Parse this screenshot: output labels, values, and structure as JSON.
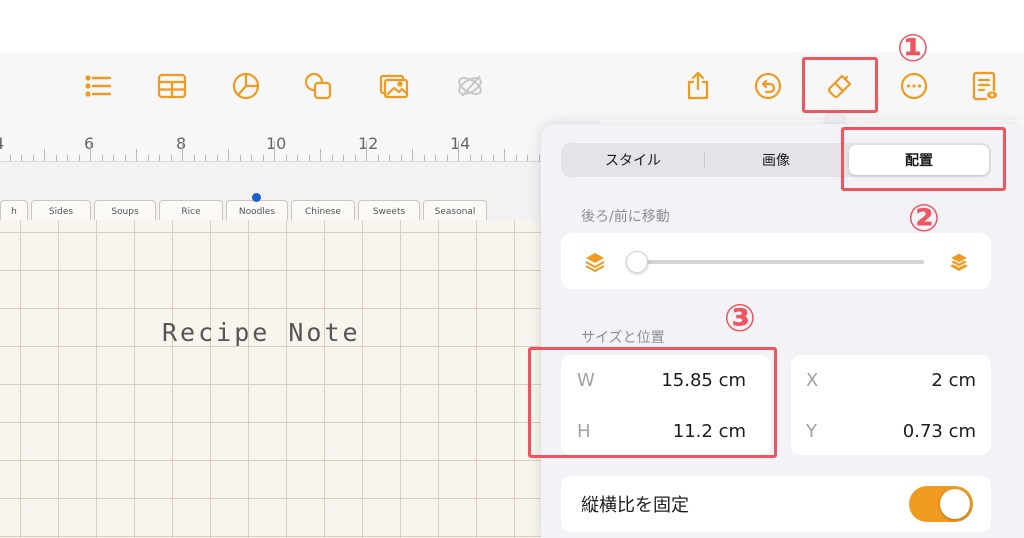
{
  "toolbar": {
    "icons": [
      "list-icon",
      "table-icon",
      "chart-icon",
      "shapes-icon",
      "media-icon",
      "drawing-icon",
      "share-icon",
      "undo-icon",
      "format-brush-icon",
      "more-icon",
      "document-view-icon"
    ],
    "accent_color": "#f19a20"
  },
  "ruler": {
    "labels": [
      "4",
      "6",
      "8",
      "10",
      "12",
      "14"
    ]
  },
  "document": {
    "tabs": [
      "h",
      "Sides",
      "Soups",
      "Rice",
      "Noodles",
      "Chinese",
      "Sweets",
      "Seasonal"
    ],
    "title": "Recipe Note"
  },
  "panel": {
    "tabs": [
      "スタイル",
      "画像",
      "配置"
    ],
    "active_tab": "配置",
    "arrange": {
      "label": "後ろ/前に移動",
      "slider_value": 0
    },
    "size_position": {
      "label": "サイズと位置",
      "w_label": "W",
      "w_value": "15.85 cm",
      "h_label": "H",
      "h_value": "11.2 cm",
      "x_label": "X",
      "x_value": "2 cm",
      "y_label": "Y",
      "y_value": "0.73 cm"
    },
    "lock_aspect": {
      "label": "縦横比を固定",
      "on": true
    }
  },
  "annotations": {
    "markers": [
      "①",
      "②",
      "③"
    ],
    "color": "#ee5560"
  }
}
